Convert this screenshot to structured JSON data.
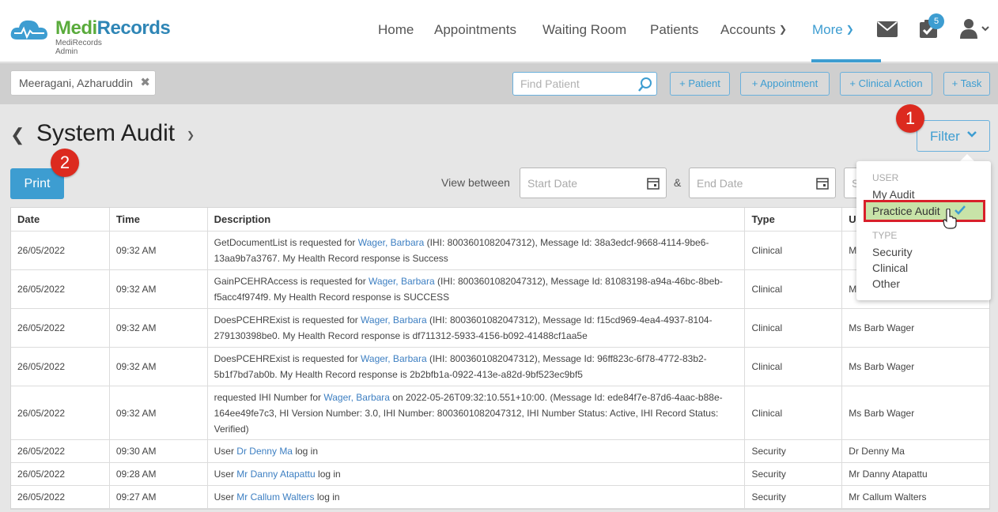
{
  "brand": {
    "name_part1": "Medi",
    "name_part2": "Records",
    "subtitle": "MediRecords Admin"
  },
  "nav": {
    "items": [
      {
        "label": "Home"
      },
      {
        "label": "Appointments"
      },
      {
        "label": "Waiting Room"
      },
      {
        "label": "Patients"
      },
      {
        "label": "Accounts"
      },
      {
        "label": "More"
      }
    ],
    "task_badge": "5"
  },
  "patient_bar": {
    "current_patient": "Meeragani, Azharuddin",
    "find_placeholder": "Find Patient",
    "actions": [
      "+ Patient",
      "+ Appointment",
      "+ Clinical Action",
      "+ Task"
    ]
  },
  "page": {
    "title": "System Audit",
    "print_label": "Print",
    "view_between_label": "View between",
    "start_placeholder": "Start Date",
    "end_placeholder": "End Date",
    "amp": "&",
    "search_partial": "S",
    "filter_label": "Filter"
  },
  "filter_menu": {
    "user_heading": "USER",
    "user_items": [
      "My Audit",
      "Practice Audit"
    ],
    "selected": "Practice Audit",
    "type_heading": "TYPE",
    "type_items": [
      "Security",
      "Clinical",
      "Other"
    ]
  },
  "callouts": [
    "1",
    "2"
  ],
  "table": {
    "headers": [
      "Date",
      "Time",
      "Description",
      "Type",
      "U"
    ],
    "rows": [
      {
        "date": "26/05/2022",
        "time": "09:32 AM",
        "pre": "GetDocumentList is requested for ",
        "link": "Wager, Barbara",
        "post": " (IHI: 8003601082047312), Message Id: 38a3edcf-9668-4114-9be6-13aa9b7a3767. My Health Record response is Success",
        "type": "Clinical",
        "user": "M"
      },
      {
        "date": "26/05/2022",
        "time": "09:32 AM",
        "pre": "GainPCEHRAccess is requested for ",
        "link": "Wager, Barbara",
        "post": " (IHI: 8003601082047312), Message Id: 81083198-a94a-46bc-8beb-f5acc4f974f9. My Health Record response is SUCCESS",
        "type": "Clinical",
        "user": "M"
      },
      {
        "date": "26/05/2022",
        "time": "09:32 AM",
        "pre": "DoesPCEHRExist is requested for ",
        "link": "Wager, Barbara",
        "post": " (IHI: 8003601082047312), Message Id: f15cd969-4ea4-4937-8104-279130398be0. My Health Record response is df711312-5933-4156-b092-41488cf1aa5e",
        "type": "Clinical",
        "user": "Ms Barb Wager"
      },
      {
        "date": "26/05/2022",
        "time": "09:32 AM",
        "pre": "DoesPCEHRExist is requested for ",
        "link": "Wager, Barbara",
        "post": " (IHI: 8003601082047312), Message Id: 96ff823c-6f78-4772-83b2-5b1f7bd7ab0b. My Health Record response is 2b2bfb1a-0922-413e-a82d-9bf523ec9bf5",
        "type": "Clinical",
        "user": "Ms Barb Wager"
      },
      {
        "date": "26/05/2022",
        "time": "09:32 AM",
        "pre": "requested IHI Number for ",
        "link": "Wager, Barbara",
        "post": " on 2022-05-26T09:32:10.551+10:00. (Message Id: ede84f7e-87d6-4aac-b88e-164ee49fe7c3, HI Version Number: 3.0, IHI Number: 8003601082047312, IHI Number Status: Active, IHI Record Status: Verified)",
        "type": "Clinical",
        "user": "Ms Barb Wager"
      },
      {
        "date": "26/05/2022",
        "time": "09:30 AM",
        "pre": "User ",
        "link": "Dr Denny Ma",
        "post": " log in",
        "type": "Security",
        "user": "Dr Denny Ma"
      },
      {
        "date": "26/05/2022",
        "time": "09:28 AM",
        "pre": "User ",
        "link": "Mr Danny Atapattu",
        "post": " log in",
        "type": "Security",
        "user": "Mr Danny Atapattu"
      },
      {
        "date": "26/05/2022",
        "time": "09:27 AM",
        "pre": "User ",
        "link": "Mr Callum Walters",
        "post": " log in",
        "type": "Security",
        "user": "Mr Callum Walters"
      }
    ]
  }
}
